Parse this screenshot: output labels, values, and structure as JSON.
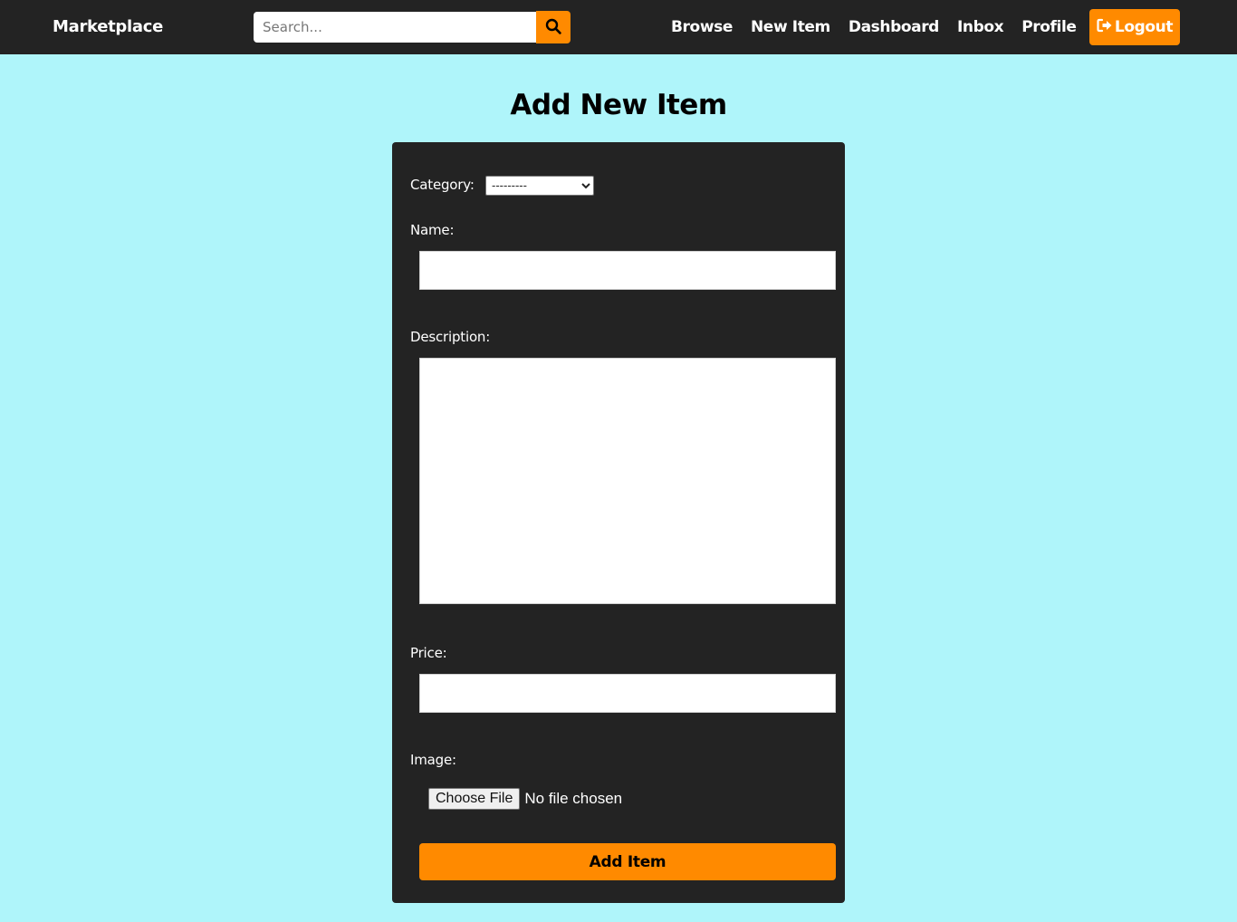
{
  "navbar": {
    "brand": "Marketplace",
    "search_placeholder": "Search...",
    "search_icon": "search-icon",
    "links": [
      {
        "label": "Browse"
      },
      {
        "label": "New Item"
      },
      {
        "label": "Dashboard"
      },
      {
        "label": "Inbox"
      },
      {
        "label": "Profile"
      }
    ],
    "logout_label": "Logout",
    "logout_icon": "logout-icon"
  },
  "page": {
    "title": "Add New Item"
  },
  "form": {
    "category_label": "Category:",
    "category_selected": "---------",
    "name_label": "Name:",
    "name_value": "",
    "description_label": "Description:",
    "description_value": "",
    "price_label": "Price:",
    "price_value": "",
    "image_label": "Image:",
    "file_button_label": "Choose File",
    "file_status": "No file chosen",
    "submit_label": "Add Item"
  },
  "colors": {
    "background": "#aff5fa",
    "navbar": "#232323",
    "card": "#232323",
    "accent": "#ff8a00",
    "text_light": "#ffffff"
  }
}
